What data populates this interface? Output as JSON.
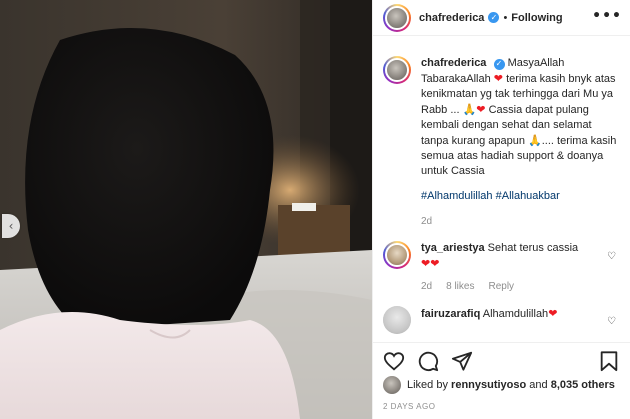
{
  "header": {
    "username": "chafrederica",
    "separator": "•",
    "follow_status": "Following",
    "more": "•••"
  },
  "caption": {
    "username": "chafrederica",
    "text_1": "MasyaAllah TabarakaAllah",
    "heart_1": "❤",
    "text_2": "terima kasih bnyk atas kenikmatan yg tak terhingga dari Mu ya Rabb ...",
    "pray_1": "🙏",
    "heart_2": "❤",
    "text_3": "Cassia dapat pulang kembali dengan sehat dan selamat tanpa kurang apapun",
    "pray_2": "🙏",
    "text_4": ".... terima kasih semua atas hadiah support & doanya untuk Cassia",
    "hashtag_1": "#Alhamdulillah",
    "hashtag_2": "#Allahuakbar",
    "time": "2d"
  },
  "comments": [
    {
      "username": "tya_ariestya",
      "text": "Sehat terus cassia",
      "hearts": "❤❤",
      "time": "2d",
      "likes": "8 likes",
      "reply": "Reply",
      "like_icon": "heart-outline-icon"
    },
    {
      "username": "fairuzarafiq",
      "text": "Alhamdulillah",
      "heart": "❤",
      "like_icon": "heart-outline-icon"
    }
  ],
  "liked_by": {
    "prefix": "Liked by",
    "user": "rennysutiyoso",
    "and": "and",
    "others": "8,035 others"
  },
  "post_date": "2 DAYS AGO",
  "icons": {
    "like": "heart-outline-icon",
    "comment": "comment-icon",
    "share": "paper-plane-icon",
    "save": "bookmark-icon",
    "verified": "verified-badge-icon",
    "prev": "chevron-left-icon"
  },
  "colors": {
    "link": "#00376b",
    "verified": "#3897f0",
    "heart": "#ed1c24",
    "muted": "#8e8e8e"
  }
}
